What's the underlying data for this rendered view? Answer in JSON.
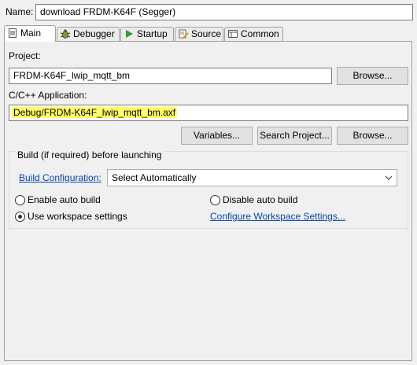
{
  "header": {
    "name_label": "Name:",
    "name_value": "download FRDM-K64F (Segger)"
  },
  "tabs": [
    {
      "label": "Main",
      "icon": "page-icon",
      "active": true
    },
    {
      "label": "Debugger",
      "icon": "bug-icon"
    },
    {
      "label": "Startup",
      "icon": "play-icon"
    },
    {
      "label": "Source",
      "icon": "source-icon"
    },
    {
      "label": "Common",
      "icon": "common-icon"
    }
  ],
  "main": {
    "project_label": "Project:",
    "project_value": "FRDM-K64F_lwip_mqtt_bm",
    "browse_label": "Browse...",
    "app_label": "C/C++ Application:",
    "app_value": "Debug/FRDM-K64F_lwip_mqtt_bm.axf",
    "variables_label": "Variables...",
    "search_project_label": "Search Project...",
    "browse2_label": "Browse..."
  },
  "build": {
    "group_title": "Build (if required) before launching",
    "config_link": "Build Configuration:",
    "config_value": "Select Automatically",
    "enable_auto": "Enable auto build",
    "disable_auto": "Disable auto build",
    "use_workspace": "Use workspace settings",
    "configure_link": "Configure Workspace Settings...",
    "selected": "use_workspace"
  },
  "colors": {
    "highlight": "#ffff66",
    "link": "#0645ad"
  }
}
